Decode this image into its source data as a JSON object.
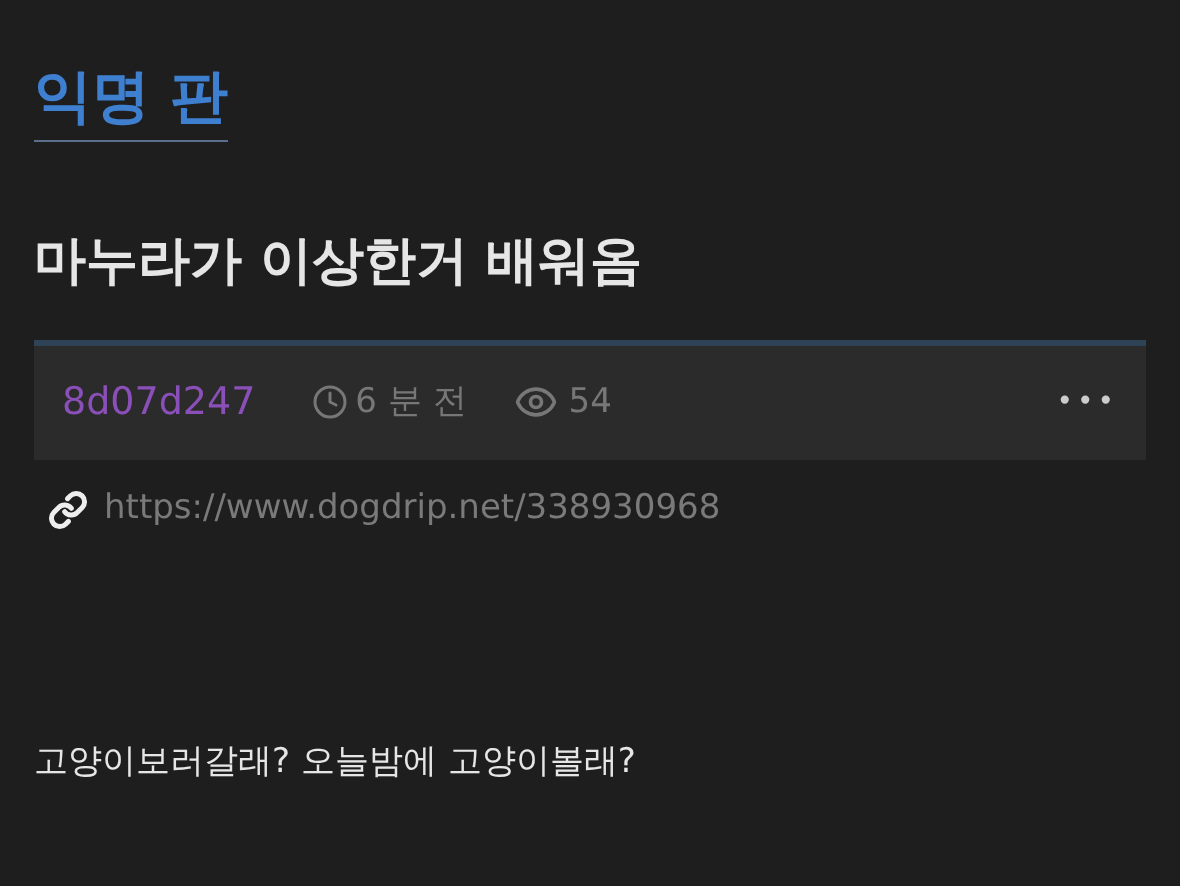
{
  "board": {
    "title": "익명 판"
  },
  "post": {
    "title": "마누라가 이상한거 배워옴",
    "meta": {
      "author": "8d07d247",
      "time": "6 분 전",
      "views": "54",
      "more": "•••"
    },
    "url": "https://www.dogdrip.net/338930968",
    "body": "고양이보러갈래? 오늘밤에 고양이볼래?"
  }
}
